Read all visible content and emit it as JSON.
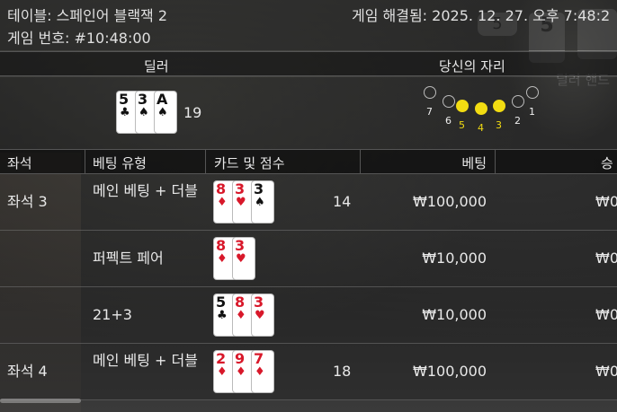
{
  "header": {
    "table": "테이블: 스페인어 블랙잭 2",
    "game_number": "게임 번호: #10:48:00",
    "resolved": "게임 해결됨: 2025. 12. 27. 오후 7:48:2"
  },
  "background_ghost": {
    "badge": "5",
    "card_rank": "5",
    "text": "딜러 핸드"
  },
  "sections": {
    "dealer": "딜러",
    "your_seat": "당신의 자리"
  },
  "dealer": {
    "cards": [
      {
        "rank": "5",
        "suit": "♣",
        "color": "black"
      },
      {
        "rank": "3",
        "suit": "♠",
        "color": "black"
      },
      {
        "rank": "A",
        "suit": "♠",
        "color": "black"
      }
    ],
    "score": "19"
  },
  "seat_map": [
    {
      "label": "7",
      "active": false
    },
    {
      "label": "6",
      "active": false
    },
    {
      "label": "5",
      "active": true
    },
    {
      "label": "4",
      "active": true
    },
    {
      "label": "3",
      "active": true
    },
    {
      "label": "2",
      "active": false
    },
    {
      "label": "1",
      "active": false
    }
  ],
  "table_headers": {
    "seat": "좌석",
    "bet_type": "베팅 유형",
    "cards_score": "카드 및 점수",
    "bet": "베팅",
    "win": "승"
  },
  "rows": [
    {
      "seat": "좌석 3",
      "bet_type": "메인 베팅 + 더블",
      "cards": [
        {
          "rank": "8",
          "suit": "♦",
          "color": "red"
        },
        {
          "rank": "3",
          "suit": "♥",
          "color": "red"
        },
        {
          "rank": "3",
          "suit": "♠",
          "color": "black"
        }
      ],
      "score": "14",
      "bet": "₩100,000",
      "win": "₩0"
    },
    {
      "seat": "",
      "bet_type": "퍼펙트 페어",
      "cards": [
        {
          "rank": "8",
          "suit": "♦",
          "color": "red"
        },
        {
          "rank": "3",
          "suit": "♥",
          "color": "red"
        }
      ],
      "score": "",
      "bet": "₩10,000",
      "win": "₩0"
    },
    {
      "seat": "",
      "bet_type": "21+3",
      "cards": [
        {
          "rank": "5",
          "suit": "♣",
          "color": "black"
        },
        {
          "rank": "8",
          "suit": "♦",
          "color": "red"
        },
        {
          "rank": "3",
          "suit": "♥",
          "color": "red"
        }
      ],
      "score": "",
      "bet": "₩10,000",
      "win": "₩0"
    },
    {
      "seat": "좌석 4",
      "bet_type": "메인 베팅 + 더블",
      "cards": [
        {
          "rank": "2",
          "suit": "♦",
          "color": "red"
        },
        {
          "rank": "9",
          "suit": "♦",
          "color": "red"
        },
        {
          "rank": "7",
          "suit": "♦",
          "color": "red"
        }
      ],
      "score": "18",
      "bet": "₩100,000",
      "win": "₩0"
    }
  ],
  "colors": {
    "active_seat": "#f2dc12",
    "red_suit": "#d8182a"
  }
}
